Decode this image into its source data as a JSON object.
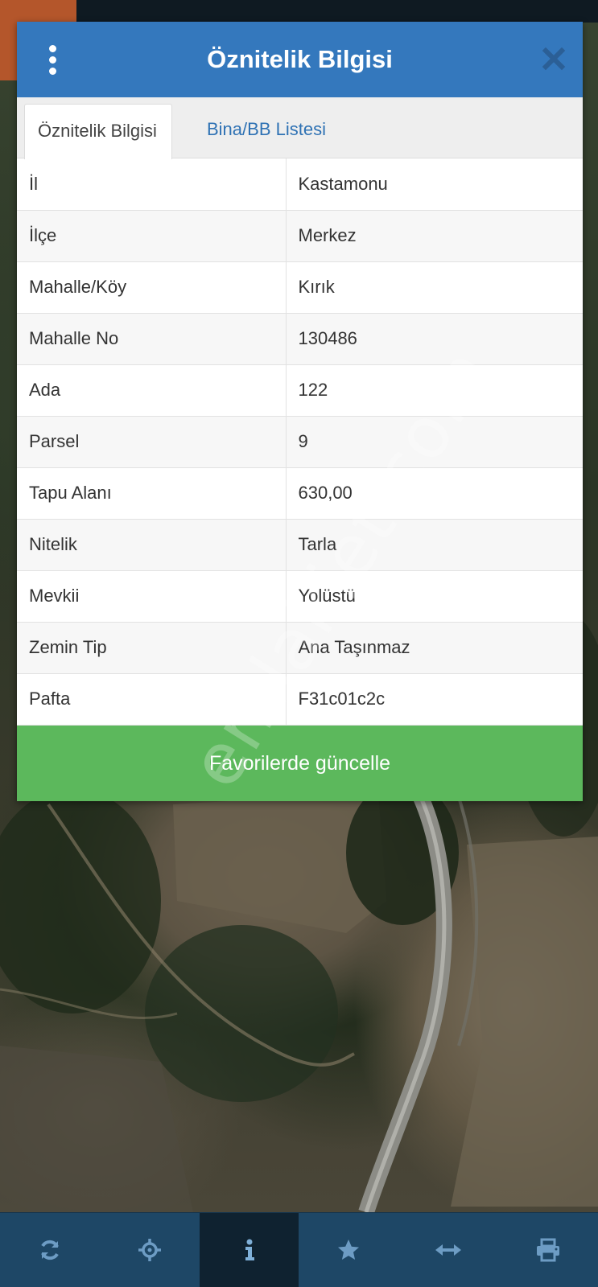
{
  "dialog": {
    "title": "Öznitelik Bilgisi",
    "menu_icon": "more-vertical-icon",
    "close_icon": "close-icon"
  },
  "tabs": [
    {
      "label": "Öznitelik Bilgisi",
      "active": true
    },
    {
      "label": "Bina/BB Listesi",
      "active": false
    }
  ],
  "attributes": [
    {
      "key": "İl",
      "value": "Kastamonu"
    },
    {
      "key": "İlçe",
      "value": "Merkez"
    },
    {
      "key": "Mahalle/Köy",
      "value": "Kırık"
    },
    {
      "key": "Mahalle No",
      "value": "130486"
    },
    {
      "key": "Ada",
      "value": "122"
    },
    {
      "key": "Parsel",
      "value": "9"
    },
    {
      "key": "Tapu Alanı",
      "value": "630,00"
    },
    {
      "key": "Nitelik",
      "value": "Tarla"
    },
    {
      "key": "Mevkii",
      "value": "Yolüstü"
    },
    {
      "key": "Zemin Tip",
      "value": "Ana Taşınmaz"
    },
    {
      "key": "Pafta",
      "value": "F31c01c2c"
    }
  ],
  "actions": {
    "update_favorites": "Favorilerde güncelle"
  },
  "watermark": "emlakjet.com",
  "toolbar": [
    {
      "icon": "refresh-icon",
      "active": false
    },
    {
      "icon": "crosshair-icon",
      "active": false
    },
    {
      "icon": "info-icon",
      "active": true
    },
    {
      "icon": "star-icon",
      "active": false
    },
    {
      "icon": "measure-arrows-icon",
      "active": false
    },
    {
      "icon": "print-icon",
      "active": false
    }
  ],
  "colors": {
    "header": "#3478bd",
    "tab_link": "#2f72b4",
    "button": "#5cb85c",
    "toolbar": "#1e4766",
    "toolbar_active": "#0f2230"
  }
}
